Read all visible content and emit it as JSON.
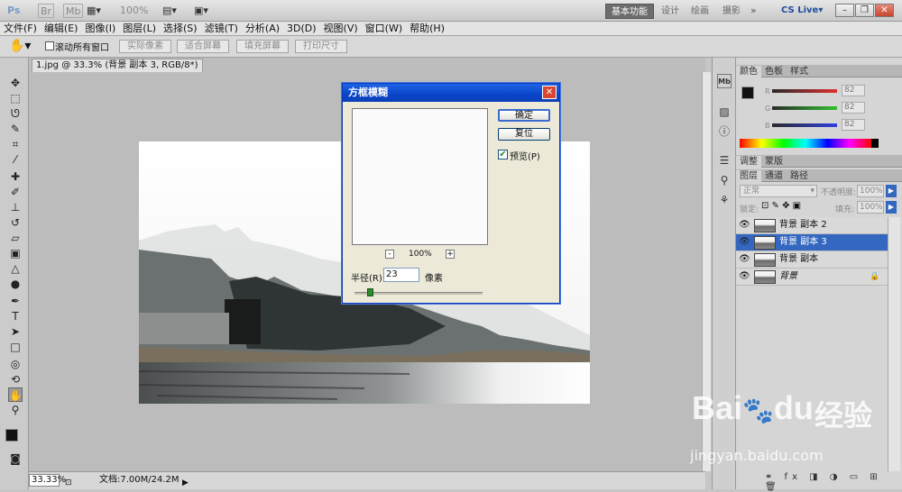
{
  "app": {
    "logo": "Ps",
    "br": "Br",
    "mb": "Mb",
    "zoom": "100%"
  },
  "workspaces": [
    "基本功能",
    "设计",
    "绘画",
    "摄影"
  ],
  "cslive": "CS Live",
  "menu": [
    "文件(F)",
    "编辑(E)",
    "图像(I)",
    "图层(L)",
    "选择(S)",
    "滤镜(T)",
    "分析(A)",
    "3D(D)",
    "视图(V)",
    "窗口(W)",
    "帮助(H)"
  ],
  "options": {
    "scroll_all": "滚动所有窗口",
    "actual_pixels": "实际像素",
    "fit_screen": "适合屏幕",
    "fill_screen": "填充屏幕",
    "print_size": "打印尺寸"
  },
  "doc": {
    "tab": "1.jpg @ 33.3% (背景 副本 3, RGB/8*) *",
    "zoom": "33.33%",
    "info": "文档:7.00M/24.2M"
  },
  "dialog": {
    "title": "方框模糊",
    "ok": "确定",
    "reset": "复位",
    "preview": "预览(P)",
    "preview_checked": true,
    "zoom": "100%",
    "zoom_minus": "-",
    "zoom_plus": "+",
    "radius_label": "半径(R):",
    "radius": "23",
    "unit": "像素"
  },
  "color_panel": {
    "tabs": [
      "颜色",
      "色板",
      "样式"
    ],
    "r": "82",
    "g": "82",
    "b": "82",
    "labels": [
      "R",
      "G",
      "B"
    ]
  },
  "adjust_tabs": [
    "调整",
    "蒙版"
  ],
  "layers_panel": {
    "tabs": [
      "图层",
      "通道",
      "路径"
    ],
    "blend": "正常",
    "opacity_label": "不透明度:",
    "opacity": "100%",
    "lock_label": "锁定:",
    "fill_label": "填充:",
    "fill": "100%",
    "layers": [
      {
        "name": "背景 副本 2",
        "selected": false
      },
      {
        "name": "背景 副本 3",
        "selected": true
      },
      {
        "name": "背景 副本",
        "selected": false
      },
      {
        "name": "背景",
        "selected": false,
        "locked": true
      }
    ]
  },
  "watermark": {
    "brand": "Bai",
    "brand2": "du",
    "cn": "经验",
    "url": "jingyan.baidu.com"
  },
  "colors": {
    "accent": "#3468c0",
    "dialog_title": "#0a45c8"
  }
}
